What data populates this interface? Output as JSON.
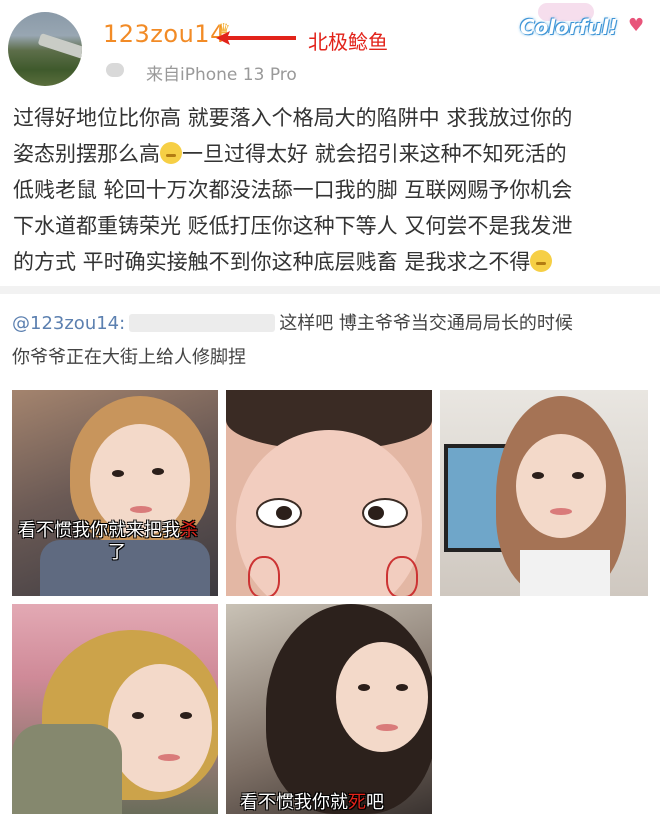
{
  "header": {
    "username": "123zou14",
    "annotation": "北极鲶鱼",
    "meta_source": "来自iPhone 13 Pro",
    "badge_text": "Colorful!"
  },
  "post": {
    "line1": "过得好地位比你高 就要落入个格局大的陷阱中 求我放过你的",
    "line2a": "姿态别摆那么高",
    "line2b": "一旦过得太好 就会招引来这种不知死活的",
    "line3": "低贱老鼠 轮回十万次都没法舔一口我的脚 互联网赐予你机会",
    "line4": "下水道都重铸荣光 贬低打压你这种下等人 又何尝不是我发泄",
    "line5": "的方式 平时确实接触不到你这种底层贱畜 是我求之不得"
  },
  "reply": {
    "mention": "@123zou14:",
    "text1": "这样吧 博主爷爷当交通局局长的时候",
    "text2": "你爷爷正在大街上给人修脚捏"
  },
  "photos": {
    "p1_caption_a": "看不惯我你就来把我",
    "p1_caption_mark": "杀",
    "p1_caption_b": "了",
    "p5_caption_a": "看不惯我你就",
    "p5_caption_mark": "死",
    "p5_caption_b": "吧"
  },
  "colors": {
    "username": "#f28b26",
    "annotation": "#e2231a",
    "mention": "#5c80b0"
  },
  "icons": [
    "crown-icon",
    "red-arrow-icon",
    "smirk-emoji-icon"
  ]
}
